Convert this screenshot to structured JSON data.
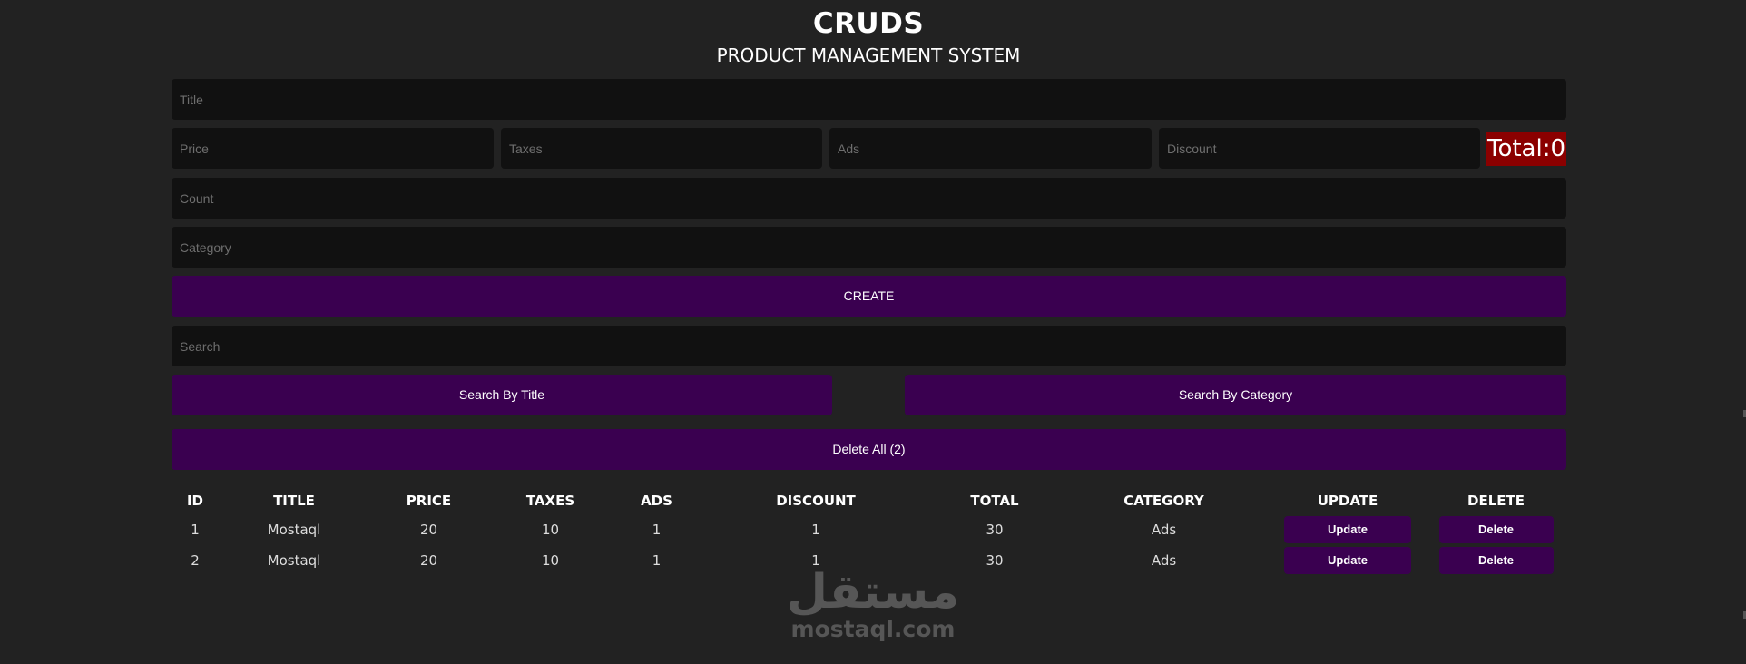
{
  "header": {
    "brand": "CRUDS",
    "subtitle": "PRODUCT MANAGEMENT SYSTEM"
  },
  "form": {
    "title_placeholder": "Title",
    "price_placeholder": "Price",
    "taxes_placeholder": "Taxes",
    "ads_placeholder": "Ads",
    "discount_placeholder": "Discount",
    "total_label": "Total:0",
    "count_placeholder": "Count",
    "category_placeholder": "Category",
    "create_label": "CREATE"
  },
  "search": {
    "placeholder": "Search",
    "by_title_label": "Search By Title",
    "by_category_label": "Search By Category"
  },
  "delete_all_label": "Delete All (2)",
  "table": {
    "headers": [
      "ID",
      "TITLE",
      "PRICE",
      "TAXES",
      "ADS",
      "DISCOUNT",
      "TOTAL",
      "CATEGORY",
      "UPDATE",
      "DELETE"
    ],
    "rows": [
      {
        "id": "1",
        "title": "Mostaql",
        "price": "20",
        "taxes": "10",
        "ads": "1",
        "discount": "1",
        "total": "30",
        "category": "Ads",
        "update": "Update",
        "delete": "Delete"
      },
      {
        "id": "2",
        "title": "Mostaql",
        "price": "20",
        "taxes": "10",
        "ads": "1",
        "discount": "1",
        "total": "30",
        "category": "Ads",
        "update": "Update",
        "delete": "Delete"
      }
    ]
  },
  "watermark": {
    "arabic": "مستقل",
    "latin": "mostaql.com"
  },
  "colors": {
    "background": "#222222",
    "input_background": "#111111",
    "button_purple": "#3a0050",
    "total_red": "#8b0000"
  }
}
